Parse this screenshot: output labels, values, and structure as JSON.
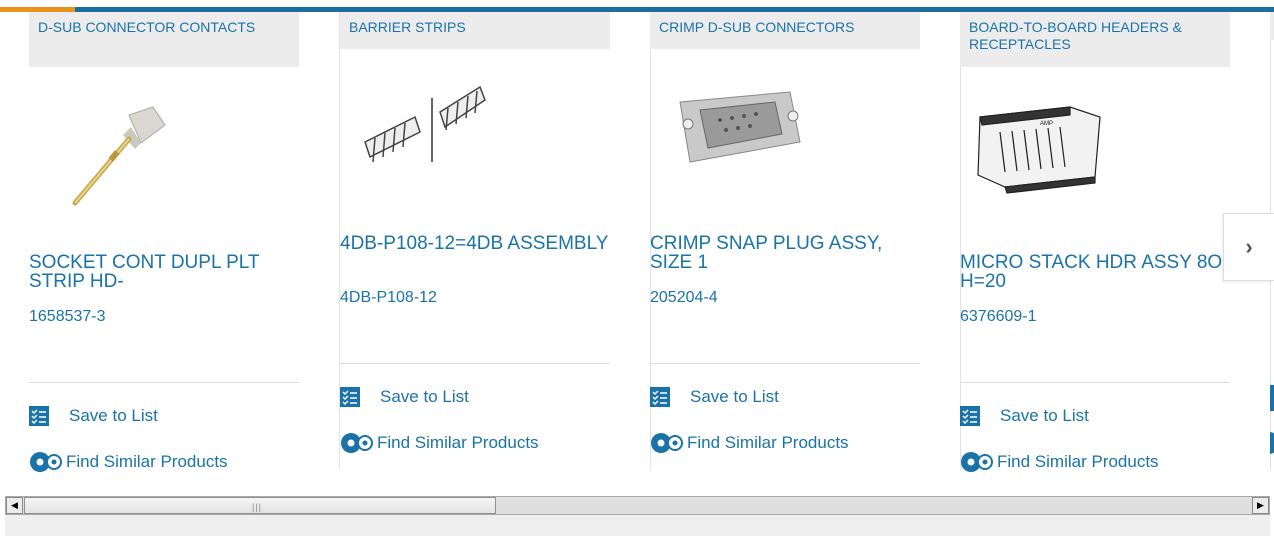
{
  "cards": [
    {
      "category": "D-SUB CONNECTOR CONTACTS",
      "title": "SOCKET CONT DUPL PLT STRIP HD-",
      "part_number": "1658537-3",
      "save_label": "Save to List",
      "similar_label": "Find Similar Products"
    },
    {
      "category": "BARRIER STRIPS",
      "title": "4DB-P108-12=4DB ASSEMBLY",
      "part_number": "4DB-P108-12",
      "save_label": "Save to List",
      "similar_label": "Find Similar Products"
    },
    {
      "category": "CRIMP D-SUB CONNECTORS",
      "title": "CRIMP SNAP PLUG ASSY, SIZE 1",
      "part_number": "205204-4",
      "save_label": "Save to List",
      "similar_label": "Find Similar Products"
    },
    {
      "category": "BOARD-TO-BOARD HEADERS & RECEPTACLES",
      "title": "MICRO STACK HDR ASSY 8OP H=20",
      "part_number": "6376609-1",
      "save_label": "Save to List",
      "similar_label": "Find Similar Products"
    }
  ],
  "carousel": {
    "next_icon": "chevron-right-icon"
  },
  "colors": {
    "link": "#1a73a8",
    "topbar": "#1a6fa0",
    "accent": "#e8931c",
    "category_bg": "#ececec"
  }
}
